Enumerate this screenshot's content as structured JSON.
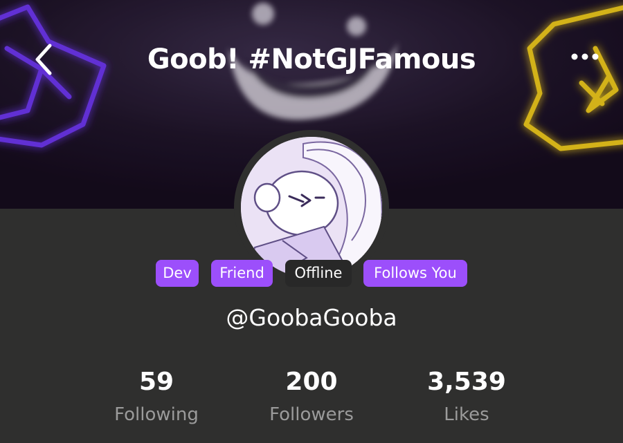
{
  "header": {
    "title": "Goob! #NotGJFamous",
    "back_icon": "chevron-left-icon",
    "more_icon": "more-horizontal-icon"
  },
  "badges": [
    {
      "label": "Dev",
      "style": "purple"
    },
    {
      "label": "Friend",
      "style": "purple"
    },
    {
      "label": "Offline",
      "style": "dark"
    },
    {
      "label": "Follows You",
      "style": "purple"
    }
  ],
  "profile": {
    "username": "@GoobaGooba"
  },
  "stats": [
    {
      "value": "59",
      "label": "Following"
    },
    {
      "value": "200",
      "label": "Followers"
    },
    {
      "value": "3,539",
      "label": "Likes"
    }
  ],
  "colors": {
    "accent": "#9c4ffb",
    "banner_bg": "#1c1126",
    "page_bg": "#2f2f2e",
    "muted_text": "#9b9b9b"
  }
}
